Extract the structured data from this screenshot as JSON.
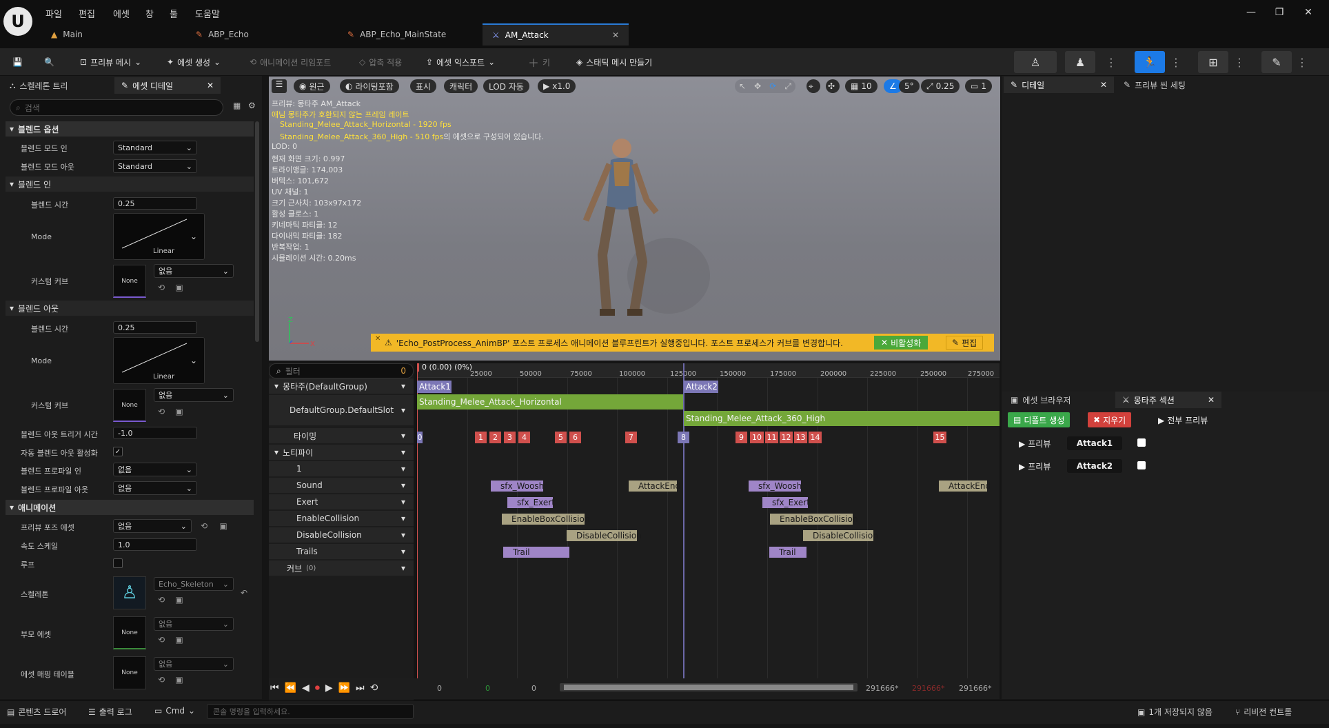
{
  "menu": [
    "파일",
    "편집",
    "에셋",
    "창",
    "툴",
    "도움말"
  ],
  "tabs": [
    {
      "label": "Main"
    },
    {
      "label": "ABP_Echo"
    },
    {
      "label": "ABP_Echo_MainState"
    },
    {
      "label": "AM_Attack"
    }
  ],
  "toolbar": {
    "preview_mesh": "프리뷰 메시",
    "create_asset": "에셋 생성",
    "reimport": "애니메이션 리임포트",
    "apply_compress": "압축 적용",
    "export_asset": "에셋 익스포트",
    "key": "키",
    "make_static_mesh": "스태틱 메시 만들기"
  },
  "left_panel": {
    "tabs": [
      "스켈레톤 트리",
      "에셋 디테일"
    ],
    "search_placeholder": "검색",
    "sections": {
      "blend_options": "블렌드 옵션",
      "blend_in": "블렌드 인",
      "blend_out": "블렌드 아웃",
      "animation": "애니메이션"
    },
    "blend_mode_in_label": "블렌드 모드 인",
    "blend_mode_in": "Standard",
    "blend_mode_out_label": "블렌드 모드 아웃",
    "blend_mode_out": "Standard",
    "blend_time_label": "블렌드 시간",
    "blend_in_time": "0.25",
    "blend_out_time": "0.25",
    "mode_label": "Mode",
    "curve_mode": "Linear",
    "custom_curve_label": "커스텀 커브",
    "none": "None",
    "none_option": "없음",
    "blend_out_trigger_label": "블렌드 아웃 트리거 시간",
    "blend_out_trigger": "-1.0",
    "auto_blend_out_label": "자동 블렌드 아웃 활성화",
    "blend_profile_in_label": "블렌드 프로파일 인",
    "blend_profile_out_label": "블렌드 프로파일 아웃",
    "preview_pose_label": "프리뷰 포즈 에셋",
    "rate_scale_label": "속도 스케일",
    "rate_scale": "1.0",
    "loop_label": "루프",
    "skeleton_label": "스켈레톤",
    "skeleton_value": "Echo_Skeleton",
    "parent_asset_label": "부모 에셋",
    "asset_mapping_label": "에셋 매핑 테이블"
  },
  "viewport": {
    "buttons": [
      "원근",
      "라이팅포함",
      "표시",
      "캐릭터",
      "LOD 자동",
      "x1.0"
    ],
    "right_controls": {
      "grid": "10",
      "angle": "5°",
      "scale": "0.25",
      "camera": "1"
    },
    "overlay": {
      "preview": "프리뷰: 몽타주 AM_Attack",
      "warning": "애님 몽타주가 호환되지 않는 프레임 레이트",
      "line1": "Standing_Melee_Attack_Horizontal - 1920 fps",
      "line2": "Standing_Melee_Attack_360_High - 510 fps",
      "line2_suffix": "의 에셋으로 구성되어 있습니다.",
      "stats": [
        "LOD: 0",
        "현재 화면 크기: 0.997",
        "트라이앵글: 174,003",
        "버텍스: 101,672",
        "UV 채널: 1",
        "크기 근사치: 103x97x172",
        "활성 클로스: 1",
        "키네마틱 파티클: 12",
        "다이내믹 파티클: 182",
        "반복작업: 1",
        "시뮬레이션 시간: 0.20ms"
      ]
    },
    "warnbar": {
      "text": "'Echo_PostProcess_AnimBP' 포스트 프로세스 애니메이션 블루프린트가 실행중입니다. 포스트 프로세스가 커브를 변경합니다.",
      "disable": "비활성화",
      "edit": "편집"
    }
  },
  "timeline": {
    "filter_placeholder": "필터",
    "filter_count": "0",
    "position": "0 (0.00) (0%)",
    "ticks": [
      "25000",
      "50000",
      "75000",
      "100000",
      "125000",
      "150000",
      "175000",
      "200000",
      "225000",
      "250000",
      "275000"
    ],
    "tracks": {
      "montage": "몽타주(DefaultGroup)",
      "slot": "DefaultGroup.DefaultSlot",
      "timing": "타이밍",
      "notifies": "노티파이",
      "n1": "1",
      "sound": "Sound",
      "exert": "Exert",
      "enable": "EnableCollision",
      "disable": "DisableCollision",
      "trails": "Trails",
      "curves": "커브",
      "curves_count": "(0)"
    },
    "sections": [
      "Attack1",
      "Attack2"
    ],
    "anims": [
      "Standing_Melee_Attack_Horizontal",
      "Standing_Melee_Attack_360_High"
    ],
    "timing_markers": [
      "0",
      "1",
      "2",
      "3",
      "4",
      "5",
      "6",
      "7",
      "8",
      "9",
      "10",
      "11",
      "12",
      "13",
      "14",
      "15"
    ],
    "notifies": {
      "woosh": "sfx_Woosh",
      "attack_end": "AttackEnd",
      "exert": "sfx_Exert",
      "enable": "EnableBoxCollision",
      "disable": "DisableCollision",
      "trail": "Trail"
    },
    "transport": {
      "a": "0",
      "b": "0",
      "c": "0",
      "end1": "291666*",
      "end2": "291666*",
      "end3": "291666*"
    }
  },
  "right_panel": {
    "tabs": [
      "디테일",
      "프리뷰 씬 세팅"
    ],
    "bottom_tabs": [
      "에셋 브라우저",
      "몽타주 섹션"
    ],
    "create_default": "디폴트 생성",
    "clear": "지우기",
    "preview_all": "전부 프리뷰",
    "preview": "프리뷰",
    "sections": [
      "Attack1",
      "Attack2"
    ]
  },
  "statusbar": {
    "content_drawer": "콘텐츠 드로어",
    "output_log": "출력 로그",
    "cmd": "Cmd",
    "cmd_placeholder": "콘솔 명령을 입력하세요.",
    "unsaved": "1개 저장되지 않음",
    "revision": "리비전 컨트롤"
  },
  "colors": {
    "accent": "#1c7ae6",
    "section": "#7c77b6",
    "anim": "#74a739",
    "timing": "#d0504d",
    "notify": "#a9a282",
    "warn": "#f2b826"
  }
}
